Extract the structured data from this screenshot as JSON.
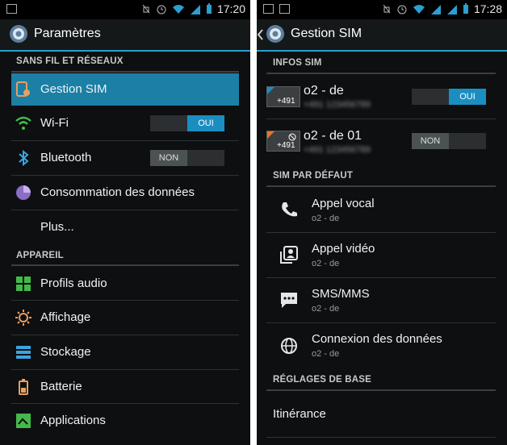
{
  "left": {
    "status_time": "17:20",
    "title": "Paramètres",
    "sections": {
      "wireless": "SANS FIL ET RÉSEAUX",
      "device": "APPAREIL"
    },
    "items": [
      {
        "label": "Gestion SIM",
        "icon": "sim-settings-icon"
      },
      {
        "label": "Wi-Fi",
        "icon": "wifi-icon",
        "toggle": "OUI"
      },
      {
        "label": "Bluetooth",
        "icon": "bluetooth-icon",
        "toggle": "NON"
      },
      {
        "label": "Consommation des données",
        "icon": "data-usage-icon"
      },
      {
        "label": "Plus...",
        "icon": ""
      },
      {
        "label": "Profils audio",
        "icon": "audio-profiles-icon"
      },
      {
        "label": "Affichage",
        "icon": "display-icon"
      },
      {
        "label": "Stockage",
        "icon": "storage-icon"
      },
      {
        "label": "Batterie",
        "icon": "battery-icon"
      },
      {
        "label": "Applications",
        "icon": "applications-icon"
      }
    ]
  },
  "right": {
    "status_time": "17:28",
    "title": "Gestion SIM",
    "sections": {
      "sim_info": "INFOS SIM",
      "default_sim": "SIM PAR DÉFAUT",
      "basic": "RÉGLAGES DE BASE"
    },
    "sims": [
      {
        "name": "o2 - de",
        "card_number": "+491",
        "number_hidden": "+491 123456789",
        "toggle": "OUI",
        "accent": "#1b8ec1"
      },
      {
        "name": "o2 - de 01",
        "card_number": "+491",
        "number_hidden": "+491 123456789",
        "toggle": "NON",
        "accent": "#e8722c"
      }
    ],
    "defaults": [
      {
        "title": "Appel vocal",
        "sub": "o2 - de",
        "icon": "phone-icon"
      },
      {
        "title": "Appel vidéo",
        "sub": "o2 - de",
        "icon": "video-call-icon"
      },
      {
        "title": "SMS/MMS",
        "sub": "o2 - de",
        "icon": "message-icon"
      },
      {
        "title": "Connexion des données",
        "sub": "o2 - de",
        "icon": "globe-icon"
      }
    ],
    "roaming": "Itinérance"
  },
  "colors": {
    "accent": "#2a9fd0",
    "toggle_on": "#1b8ec1",
    "selected": "#1b7fa6"
  }
}
